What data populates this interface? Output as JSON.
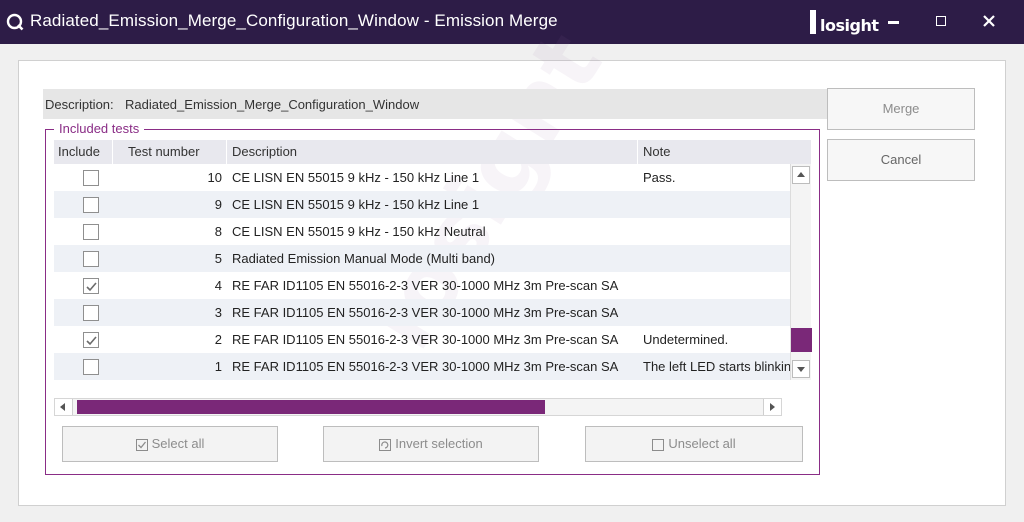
{
  "window": {
    "title": "Radiated_Emission_Merge_Configuration_Window - Emission Merge",
    "brand": "losight"
  },
  "description": {
    "label": "Description:",
    "value": "Radiated_Emission_Merge_Configuration_Window"
  },
  "buttons": {
    "merge": "Merge",
    "cancel": "Cancel",
    "select_all": "Select all",
    "invert_selection": "Invert selection",
    "unselect_all": "Unselect all"
  },
  "group": {
    "title": "Included tests",
    "columns": [
      "Include",
      "Test number",
      "Description",
      "Note"
    ],
    "rows": [
      {
        "include": false,
        "number": "10",
        "description": "CE LISN EN 55015 9 kHz - 150 kHz Line 1",
        "note": "Pass."
      },
      {
        "include": false,
        "number": "9",
        "description": "CE LISN EN 55015 9 kHz - 150 kHz Line 1",
        "note": ""
      },
      {
        "include": false,
        "number": "8",
        "description": "CE LISN EN 55015 9 kHz - 150 kHz Neutral",
        "note": ""
      },
      {
        "include": false,
        "number": "5",
        "description": "Radiated Emission Manual Mode (Multi band)",
        "note": ""
      },
      {
        "include": true,
        "number": "4",
        "description": "RE FAR ID1105 EN 55016-2-3 VER 30-1000 MHz 3m Pre-scan SA",
        "note": ""
      },
      {
        "include": false,
        "number": "3",
        "description": "RE FAR ID1105 EN 55016-2-3 VER 30-1000 MHz 3m Pre-scan SA",
        "note": ""
      },
      {
        "include": true,
        "number": "2",
        "description": "RE FAR ID1105 EN 55016-2-3 VER 30-1000 MHz 3m Pre-scan SA",
        "note": "Undetermined."
      },
      {
        "include": false,
        "number": "1",
        "description": "RE FAR ID1105 EN 55016-2-3 VER 30-1000 MHz 3m Pre-scan SA",
        "note": "The left LED starts blinking"
      }
    ]
  },
  "colors": {
    "titlebar": "#2d1c47",
    "accent": "#7a2878",
    "group_border": "#8a2d86"
  },
  "icons": {
    "app": "app-logo-icon",
    "minimize": "minimize-icon",
    "maximize": "maximize-icon",
    "close": "close-icon",
    "checkbox_checked": "check-icon"
  }
}
